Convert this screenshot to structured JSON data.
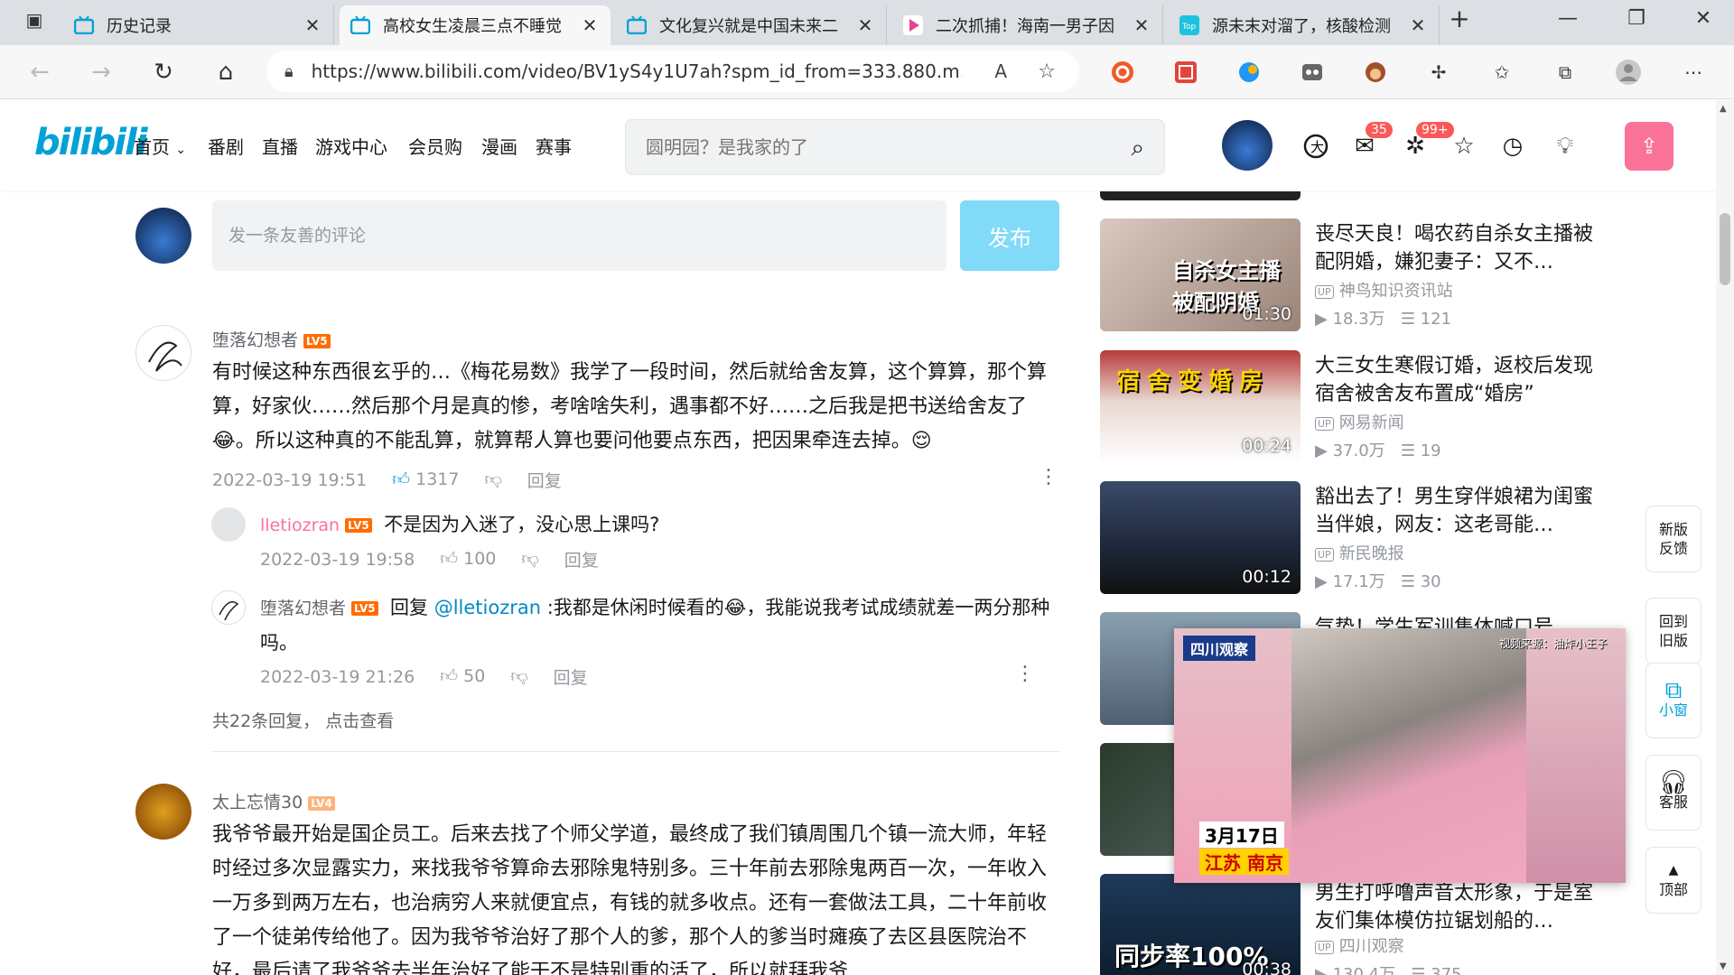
{
  "browser": {
    "tabs": [
      {
        "title": "历史记录"
      },
      {
        "title": "高校女生凌晨三点不睡觉"
      },
      {
        "title": "文化复兴就是中国未来二"
      },
      {
        "title": "二次抓捕！海南一男子因"
      },
      {
        "title": "源未末对溜了，核酸检测"
      }
    ],
    "url": "https://www.bilibili.com/video/BV1yS4y1U7ah?spm_id_from=333.880.m..."
  },
  "header": {
    "logo": "bilibili",
    "nav": [
      "首页",
      "番剧",
      "直播",
      "游戏中心",
      "会员购",
      "漫画",
      "赛事"
    ],
    "search_placeholder": "圆明园？是我家的了",
    "badges": {
      "messages": "35",
      "dynamic": "99+"
    }
  },
  "comment_box": {
    "placeholder": "发一条友善的评论",
    "submit": "发布"
  },
  "comments": [
    {
      "user": "堕落幻想者",
      "level": "LV5",
      "text": "有时候这种东西很玄乎的…《梅花易数》我学了一段时间，然后就给舍友算，这个算算，那个算算，好家伙……然后那个月是真的惨，考啥啥失利，遇事都不好……之后我是把书送给舍友了😂。所以这种真的不能乱算，就算帮人算也要问他要点东西，把因果牵连去掉。😌",
      "time": "2022-03-19 19:51",
      "likes": "1317",
      "reply_label": "回复",
      "replies": [
        {
          "user": "lletiozran",
          "level": "LV5",
          "text": "不是因为入迷了，没心思上课吗?",
          "time": "2022-03-19 19:58",
          "likes": "100",
          "reply_label": "回复"
        },
        {
          "user": "堕落幻想者",
          "level": "LV5",
          "prefix": "回复",
          "at": "@lletiozran",
          "text": " :我都是休闲时候看的😂，我能说我考试成绩就差一两分那种吗。",
          "time": "2022-03-19 21:26",
          "likes": "50",
          "reply_label": "回复"
        }
      ],
      "more": "共22条回复， 点击查看"
    },
    {
      "user": "太上忘情30",
      "level": "LV4",
      "text": "我爷爷最开始是国企员工。后来去找了个师父学道，最终成了我们镇周围几个镇一流大师，年轻时经过多次显露实力，来找我爷爷算命去邪除鬼特别多。三十年前去邪除鬼两百一次，一年收入一万多到两万左右，也治病穷人来就便宜点，有钱的就多收点。还有一套做法工具，二十年前收了一个徒弟传给他了。因为我爷爷治好了那个人的爹，那个人的爹当时瘫痪了去区县医院治不好，最后请了我爷爷去半年治好了能干不是特别重的活了，所以就拜我爷"
    }
  ],
  "recommendations": [
    {
      "title": "丧尽天良！喝农药自杀女主播被配阴婚，嫌犯妻子：又不…",
      "up": "神鸟知识资讯站",
      "views": "18.3万",
      "danmaku": "121",
      "duration": "01:30",
      "thumb_text": "自杀女主播被配阴婚"
    },
    {
      "title": "大三女生寒假订婚，返校后发现宿舍被舍友布置成“婚房”",
      "up": "网易新闻",
      "views": "37.0万",
      "danmaku": "19",
      "duration": "00:24",
      "thumb_text": "宿舍变婚房"
    },
    {
      "title": "豁出去了！男生穿伴娘裙为闺蜜当伴娘，网友：这老哥能…",
      "up": "新民晚报",
      "views": "17.1万",
      "danmaku": "30",
      "duration": "00:12",
      "thumb_text": ""
    },
    {
      "title": "气势！学生军训集体喊口号",
      "up": "",
      "views": "",
      "danmaku": "",
      "duration": "",
      "thumb_text": ""
    },
    {
      "title": "",
      "up": "",
      "views": "",
      "danmaku": "",
      "duration": "",
      "thumb_text": ""
    },
    {
      "title": "男生打呼噜声音太形象，于是室友们集体模仿拉锯划船的…",
      "up": "四川观察",
      "views": "130.4万",
      "danmaku": "375",
      "duration": "00:38",
      "thumb_text": "同步率100%"
    }
  ],
  "miniplayer": {
    "tag": "四川观察",
    "date": "3月17日",
    "place": "江苏 南京",
    "watermark": "视频来源：油炸小王子"
  },
  "sidebar": {
    "feedback": "新版反馈",
    "old": "回到旧版",
    "mini": "小窗",
    "service": "客服",
    "top": "顶部"
  },
  "colors": {
    "accent": "#00a1d6",
    "pink": "#fb7299",
    "lv5": "#ff6c00",
    "lv4": "#ffb37c"
  }
}
